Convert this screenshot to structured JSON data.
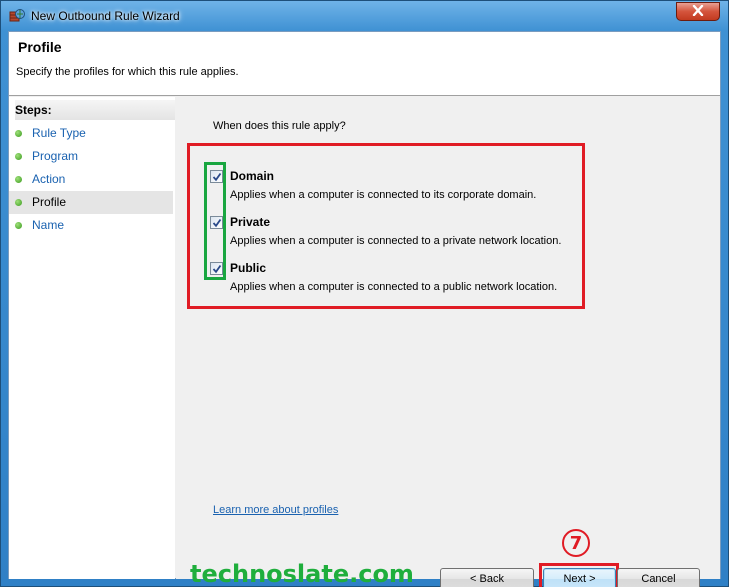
{
  "window": {
    "title": "New Outbound Rule Wizard",
    "close_icon": "close-icon"
  },
  "header": {
    "title": "Profile",
    "subtitle": "Specify the profiles for which this rule applies."
  },
  "steps": {
    "title": "Steps:",
    "items": [
      {
        "label": "Rule Type",
        "current": false
      },
      {
        "label": "Program",
        "current": false
      },
      {
        "label": "Action",
        "current": false
      },
      {
        "label": "Profile",
        "current": true
      },
      {
        "label": "Name",
        "current": false
      }
    ]
  },
  "main": {
    "question": "When does this rule apply?",
    "profiles": [
      {
        "label": "Domain",
        "description": "Applies when a computer is connected to its corporate domain.",
        "checked": true
      },
      {
        "label": "Private",
        "description": "Applies when a computer is connected to a private network location.",
        "checked": true
      },
      {
        "label": "Public",
        "description": "Applies when a computer is connected to a public network location.",
        "checked": true
      }
    ],
    "learn_more": "Learn more about profiles"
  },
  "buttons": {
    "back": "< Back",
    "next": "Next >",
    "cancel": "Cancel"
  },
  "annotations": {
    "step_number": "7",
    "watermark": "technoslate.com"
  },
  "colors": {
    "highlight_red": "#e01b24",
    "highlight_green": "#19a640",
    "link": "#1a62b0",
    "watermark": "#1fae3c"
  }
}
